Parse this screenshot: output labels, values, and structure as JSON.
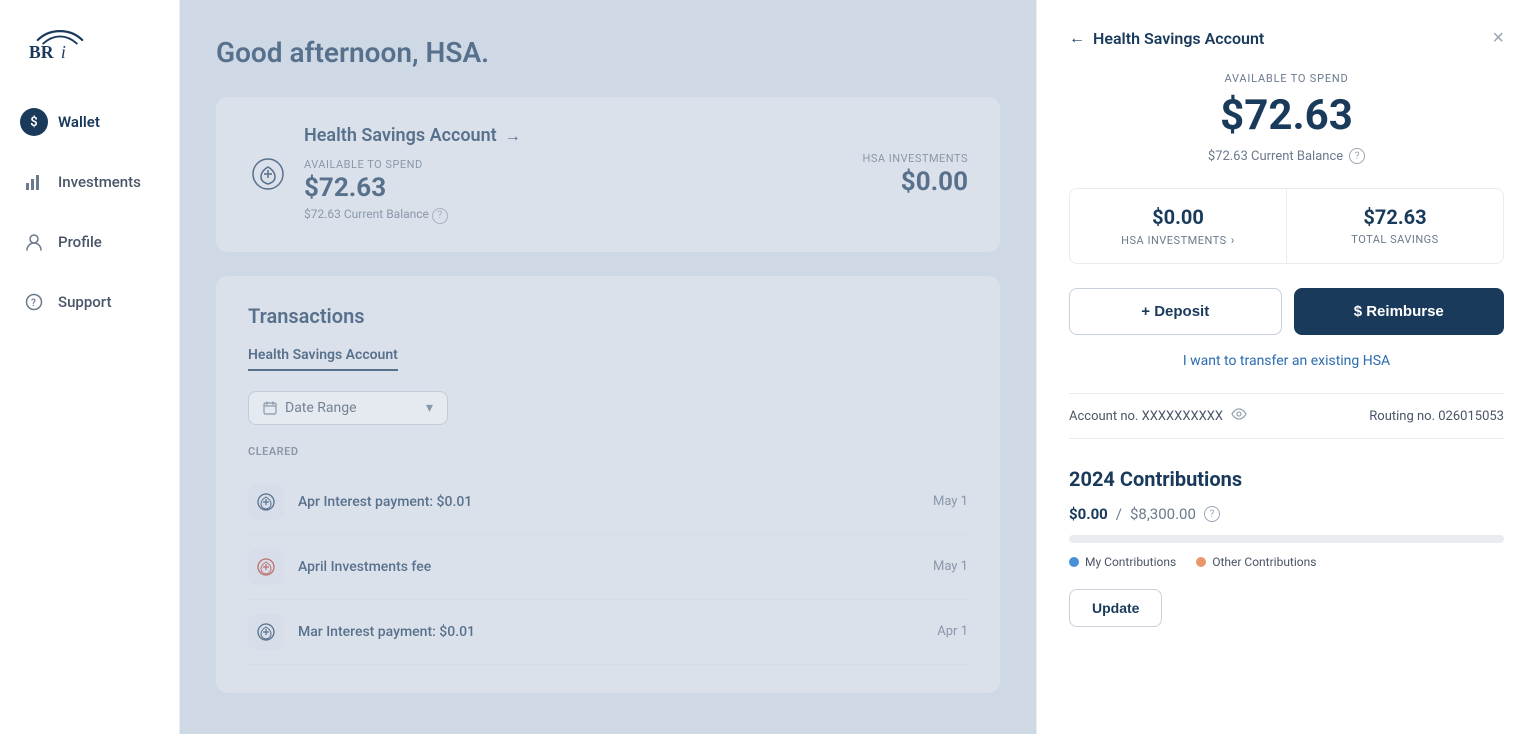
{
  "brand": {
    "name": "BRI",
    "logo_text": "BRI"
  },
  "sidebar": {
    "items": [
      {
        "id": "wallet",
        "label": "Wallet",
        "icon": "wallet-icon",
        "active": true
      },
      {
        "id": "investments",
        "label": "Investments",
        "icon": "investments-icon",
        "active": false
      },
      {
        "id": "profile",
        "label": "Profile",
        "icon": "profile-icon",
        "active": false
      },
      {
        "id": "support",
        "label": "Support",
        "icon": "support-icon",
        "active": false
      }
    ]
  },
  "main": {
    "greeting": "Good afternoon, HSA.",
    "hsa_card": {
      "title": "Health Savings Account",
      "available_label": "AVAILABLE TO SPEND",
      "amount": "$72.63",
      "current_balance_text": "$72.63 Current Balance",
      "investments_label": "HSA INVESTMENTS",
      "investments_amount": "$0.00"
    },
    "transactions": {
      "title": "Transactions",
      "tab_label": "Health Savings Account",
      "date_range_label": "Date Range",
      "cleared_label": "CLEARED",
      "rows": [
        {
          "name": "Apr Interest payment: $0.01",
          "date": "May 1",
          "icon": "interest-icon"
        },
        {
          "name": "April Investments fee",
          "date": "May 1",
          "icon": "investment-icon"
        },
        {
          "name": "Mar Interest payment: $0.01",
          "date": "Apr 1",
          "icon": "interest-icon"
        }
      ]
    }
  },
  "panel": {
    "title": "Health Savings Account",
    "close_label": "×",
    "back_label": "←",
    "available_label": "AVAILABLE TO SPEND",
    "amount": "$72.63",
    "current_balance_text": "$72.63 Current Balance",
    "stats": [
      {
        "value": "$0.00",
        "label": "HSA INVESTMENTS",
        "has_arrow": true
      },
      {
        "value": "$72.63",
        "label": "TOTAL SAVINGS",
        "has_arrow": false
      }
    ],
    "buttons": {
      "deposit": "+ Deposit",
      "reimburse": "$ Reimburse"
    },
    "transfer_link": "I want to transfer an existing HSA",
    "account_no_label": "Account no. XXXXXXXXXX",
    "routing_no_label": "Routing no. 026015053",
    "contributions": {
      "title": "2024 Contributions",
      "current": "$0.00",
      "limit": "$8,300.00",
      "progress_pct": 0,
      "legend": [
        {
          "label": "My Contributions",
          "color": "dot-blue"
        },
        {
          "label": "Other Contributions",
          "color": "dot-orange"
        }
      ],
      "update_button": "Update"
    }
  }
}
